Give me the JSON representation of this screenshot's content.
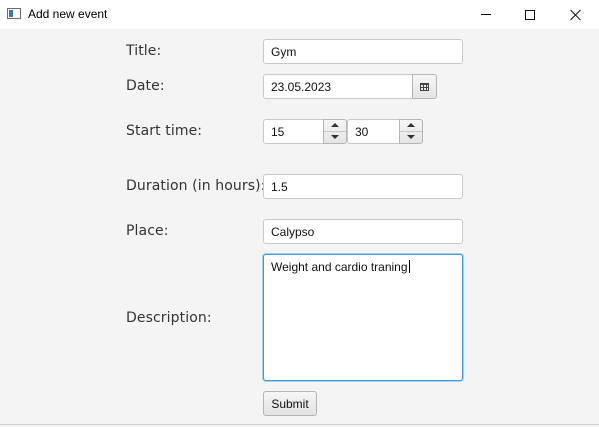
{
  "window": {
    "title": "Add new event",
    "controls": {
      "minimize": "minimize-icon",
      "maximize": "maximize-icon",
      "close": "close-icon"
    }
  },
  "form": {
    "title": {
      "label": "Title:",
      "value": "Gym"
    },
    "date": {
      "label": "Date:",
      "value": "23.05.2023",
      "picker_icon": "calendar-icon"
    },
    "start_time": {
      "label": "Start time:",
      "hour": "15",
      "minute": "30"
    },
    "duration": {
      "label": "Duration (in hours):",
      "value": "1.5"
    },
    "place": {
      "label": "Place:",
      "value": "Calypso"
    },
    "description": {
      "label": "Description:",
      "value": "Weight and cardio traning"
    },
    "submit_label": "Submit"
  },
  "colors": {
    "focus_border": "#3b9ae0",
    "background": "#f4f4f4"
  }
}
